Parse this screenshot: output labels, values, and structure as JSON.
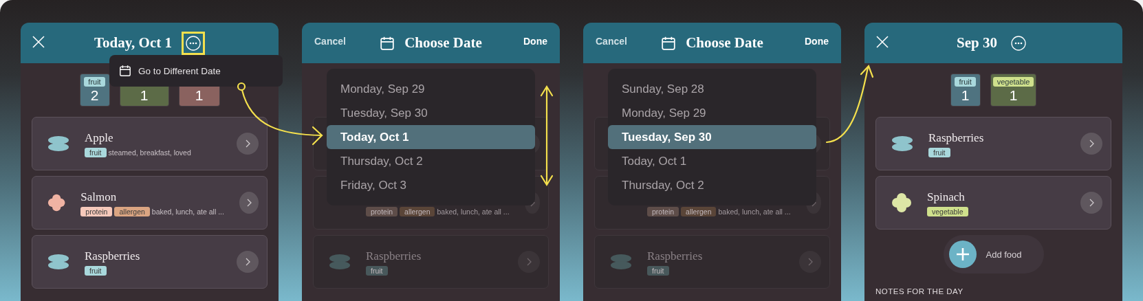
{
  "screens": [
    {
      "kind": "day",
      "header": {
        "title": "Today, Oct 1",
        "more_highlighted": true
      },
      "summary": [
        {
          "label": {
            "text": "fruit",
            "color": "#a9d8dc"
          },
          "count": "2",
          "color": "#4f7380"
        },
        {
          "count": "1",
          "color": "#5c6b47"
        },
        {
          "count": "1",
          "color": "#8a625f"
        }
      ],
      "menu": {
        "items": [
          {
            "label": "Go to Different Date"
          }
        ]
      },
      "foods": [
        {
          "name": "Apple",
          "kind": "ovals",
          "color": "#8fc4cc",
          "tags": [
            {
              "label": "fruit",
              "color": "#a9d8dc"
            }
          ],
          "note": "steamed, breakfast, loved"
        },
        {
          "name": "Salmon",
          "kind": "cloud",
          "color": "#f0b3a3",
          "tags": [
            {
              "label": "protein",
              "color": "#f6c9bb"
            },
            {
              "label": "allergen",
              "color": "#dba582"
            }
          ],
          "note": "baked, lunch, ate all ..."
        },
        {
          "name": "Raspberries",
          "kind": "ovals",
          "color": "#8fc4cc",
          "tags": [
            {
              "label": "fruit",
              "color": "#a9d8dc"
            }
          ]
        }
      ]
    },
    {
      "kind": "picker",
      "header": {
        "cancel": "Cancel",
        "title": "Choose Date",
        "done": "Done"
      },
      "dates": [
        {
          "label": "Monday, Sep 29",
          "selected": false
        },
        {
          "label": "Tuesday, Sep 30",
          "selected": false
        },
        {
          "label": "Today, Oct 1",
          "selected": true
        },
        {
          "label": "Thursday, Oct 2",
          "selected": false
        },
        {
          "label": "Friday, Oct 3",
          "selected": false
        }
      ],
      "foods": [
        {
          "kind": "hidden"
        },
        {
          "kind": "hidden",
          "tags": [
            {
              "label": "protein",
              "color": "#5e4d49"
            },
            {
              "label": "allergen",
              "color": "#5a4538"
            }
          ],
          "note": "baked, lunch, ate all ..."
        },
        {
          "name": "Raspberries",
          "kind": "ovals",
          "color": "#46595c",
          "tags": [
            {
              "label": "fruit",
              "color": "#48585b"
            }
          ]
        }
      ]
    },
    {
      "kind": "picker",
      "header": {
        "cancel": "Cancel",
        "title": "Choose Date",
        "done": "Done"
      },
      "dates": [
        {
          "label": "Sunday, Sep 28",
          "selected": false
        },
        {
          "label": "Monday, Sep 29",
          "selected": false
        },
        {
          "label": "Tuesday, Sep 30",
          "selected": true
        },
        {
          "label": "Today, Oct 1",
          "selected": false
        },
        {
          "label": "Thursday, Oct 2",
          "selected": false
        }
      ],
      "foods": [
        {
          "kind": "hidden"
        },
        {
          "kind": "hidden",
          "tags": [
            {
              "label": "protein",
              "color": "#5e4d49"
            },
            {
              "label": "allergen",
              "color": "#5a4538"
            }
          ],
          "note": "baked, lunch, ate all ..."
        },
        {
          "name": "Raspberries",
          "kind": "ovals",
          "color": "#46595c",
          "tags": [
            {
              "label": "fruit",
              "color": "#48585b"
            }
          ]
        }
      ]
    },
    {
      "kind": "day",
      "header": {
        "title": "Sep 30",
        "more_highlighted": false
      },
      "summary": [
        {
          "label": {
            "text": "fruit",
            "color": "#a9d8dc"
          },
          "count": "1",
          "color": "#4f7380"
        },
        {
          "label": {
            "text": "vegetable",
            "color": "#cfe08c"
          },
          "count": "1",
          "color": "#5c6b47"
        }
      ],
      "foods": [
        {
          "name": "Raspberries",
          "kind": "ovals",
          "color": "#8fc4cc",
          "tags": [
            {
              "label": "fruit",
              "color": "#a9d8dc"
            }
          ]
        },
        {
          "name": "Spinach",
          "kind": "cloud",
          "color": "#dde6a6",
          "tags": [
            {
              "label": "vegetable",
              "color": "#cfe08c"
            }
          ]
        }
      ],
      "add_button": {
        "label": "Add food"
      },
      "notes": {
        "heading": "NOTES FOR THE DAY"
      }
    }
  ]
}
